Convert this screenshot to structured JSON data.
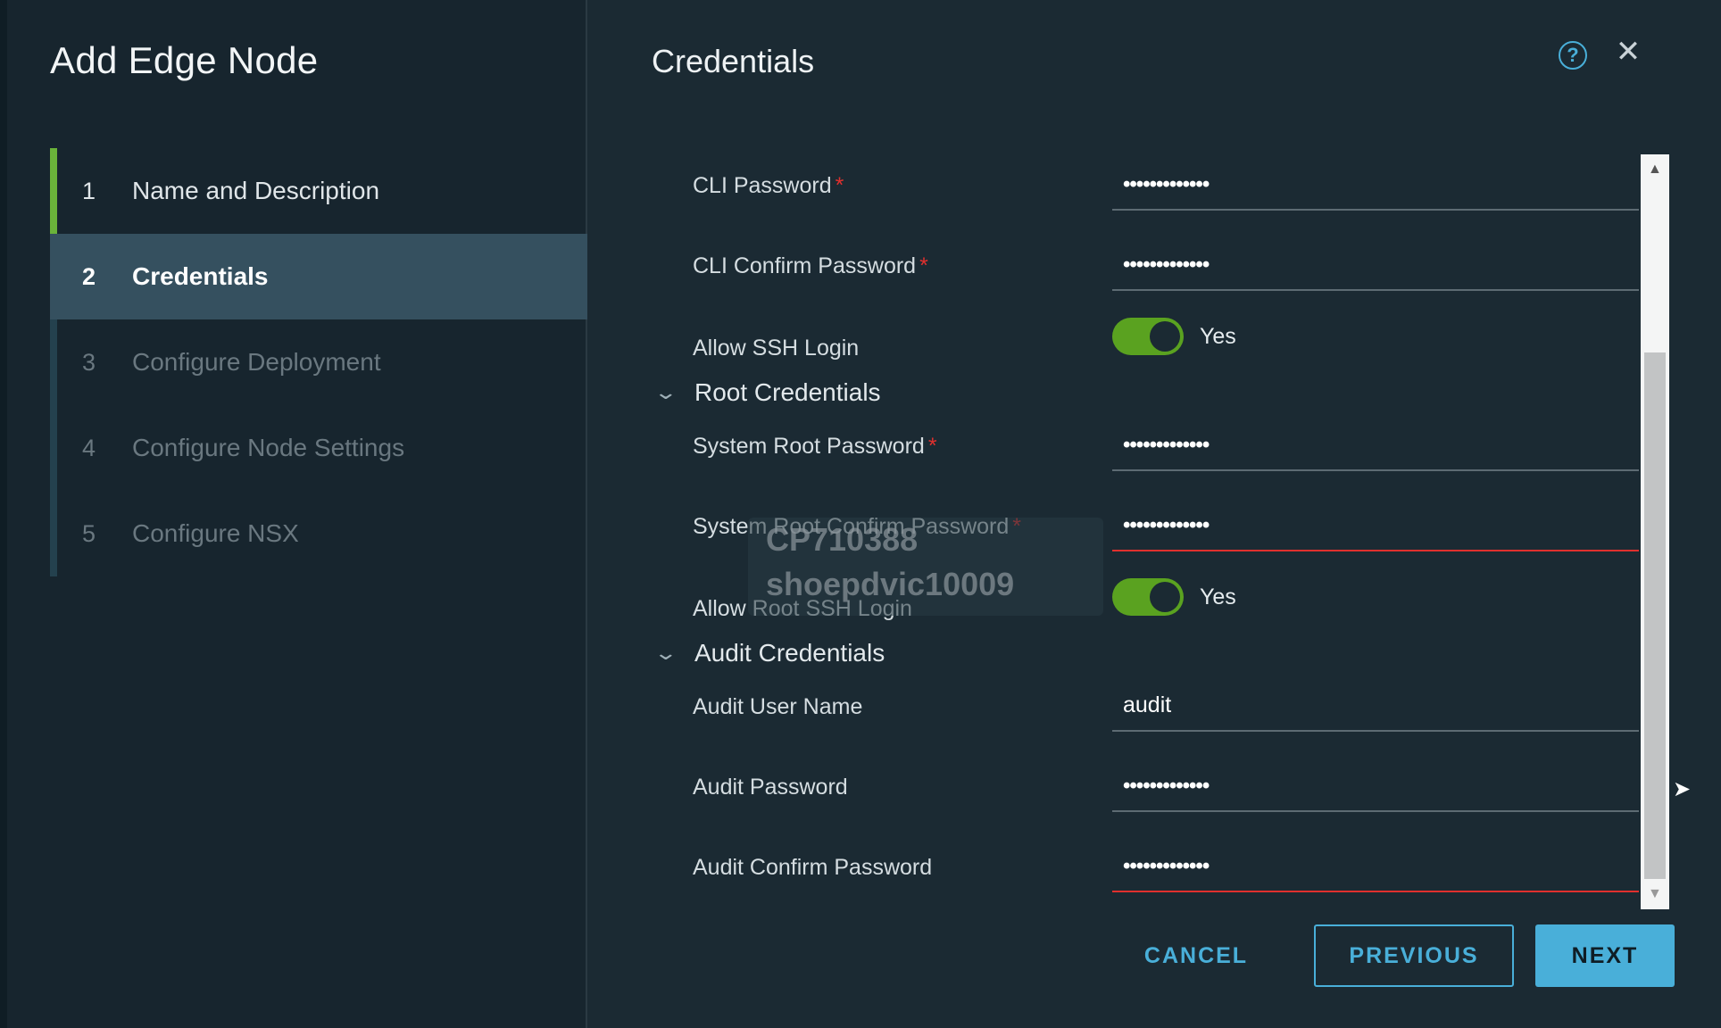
{
  "wizard": {
    "title": "Add Edge Node",
    "steps": [
      {
        "num": "1",
        "label": "Name and Description"
      },
      {
        "num": "2",
        "label": "Credentials"
      },
      {
        "num": "3",
        "label": "Configure Deployment"
      },
      {
        "num": "4",
        "label": "Configure Node Settings"
      },
      {
        "num": "5",
        "label": "Configure NSX"
      }
    ]
  },
  "page": {
    "title": "Credentials",
    "help_icon": "question-circle-icon",
    "close_icon": "close-icon"
  },
  "form": {
    "cli_password": {
      "label": "CLI Password",
      "value": "•••••••••••••",
      "required": "*"
    },
    "cli_confirm_password": {
      "label": "CLI Confirm Password",
      "value": "•••••••••••••",
      "required": "*"
    },
    "allow_ssh_login": {
      "label": "Allow SSH Login",
      "state": "Yes"
    },
    "root_section": {
      "title": "Root Credentials"
    },
    "system_root_password": {
      "label": "System Root Password",
      "value": "•••••••••••••",
      "required": "*"
    },
    "system_root_confirm_password": {
      "label": "System Root Confirm Password",
      "value": "•••••••••••••",
      "required": "*"
    },
    "allow_root_ssh_login": {
      "label": "Allow Root SSH Login",
      "state": "Yes"
    },
    "audit_section": {
      "title": "Audit Credentials"
    },
    "audit_user_name": {
      "label": "Audit User Name",
      "value": "audit"
    },
    "audit_password": {
      "label": "Audit Password",
      "value": "•••••••••••••"
    },
    "audit_confirm_password": {
      "label": "Audit Confirm Password",
      "value": "•••••••••••••"
    }
  },
  "watermark": {
    "line1": "CP710388",
    "line2": "shoepdvic10009"
  },
  "buttons": {
    "cancel": "CANCEL",
    "previous": "PREVIOUS",
    "next": "NEXT"
  },
  "colors": {
    "accent": "#49afd9",
    "toggle_on": "#5aa220",
    "error": "#e0302e",
    "step_done": "#6ab33a"
  }
}
